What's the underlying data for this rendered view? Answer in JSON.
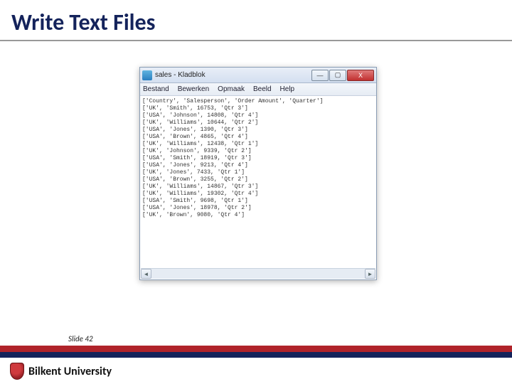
{
  "slide": {
    "title": "Write Text Files",
    "number_label": "Slide 42",
    "university": "Bilkent University"
  },
  "window": {
    "title": "sales - Kladblok",
    "menu": {
      "m1": "Bestand",
      "m2": "Bewerken",
      "m3": "Opmaak",
      "m4": "Beeld",
      "m5": "Help"
    },
    "btn_min": "—",
    "btn_max": "▢",
    "btn_close": "X",
    "scroll_left": "◄",
    "scroll_right": "►",
    "lines": [
      "['Country', 'Salesperson', 'Order Amount', 'Quarter']",
      "['UK', 'Smith', 16753, 'Qtr 3']",
      "['USA', 'Johnson', 14808, 'Qtr 4']",
      "['UK', 'Williams', 10644, 'Qtr 2']",
      "['USA', 'Jones', 1390, 'Qtr 3']",
      "['USA', 'Brown', 4865, 'Qtr 4']",
      "['UK', 'Williams', 12438, 'Qtr 1']",
      "['UK', 'Johnson', 9339, 'Qtr 2']",
      "['USA', 'Smith', 18919, 'Qtr 3']",
      "['USA', 'Jones', 9213, 'Qtr 4']",
      "['UK', 'Jones', 7433, 'Qtr 1']",
      "['USA', 'Brown', 3255, 'Qtr 2']",
      "['UK', 'Williams', 14867, 'Qtr 3']",
      "['UK', 'Williams', 19302, 'Qtr 4']",
      "['USA', 'Smith', 9698, 'Qtr 1']",
      "['USA', 'Jones', 18978, 'Qtr 2']",
      "['UK', 'Brown', 9080, 'Qtr 4']"
    ]
  }
}
